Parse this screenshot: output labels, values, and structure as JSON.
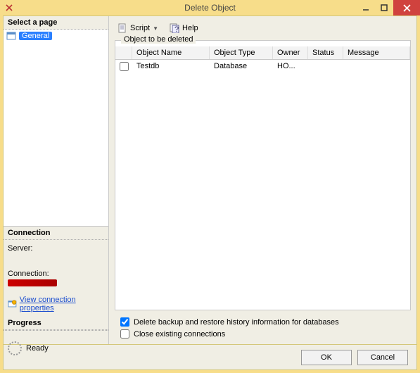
{
  "window": {
    "title": "Delete Object"
  },
  "left": {
    "pages_header": "Select a page",
    "page_general": "General",
    "connection": {
      "header": "Connection",
      "server_label": "Server:",
      "server_value": "",
      "connection_label": "Connection:",
      "view_props_link": "View connection properties"
    },
    "progress": {
      "header": "Progress",
      "status": "Ready"
    }
  },
  "toolbar": {
    "script": "Script",
    "help": "Help"
  },
  "group_label": "Object to be deleted",
  "columns": {
    "name": "Object Name",
    "type": "Object Type",
    "owner": "Owner",
    "status": "Status",
    "message": "Message"
  },
  "rows": [
    {
      "name": "Testdb",
      "type": "Database",
      "owner": "HO...",
      "status": "",
      "message": ""
    }
  ],
  "checks": {
    "delete_history": "Delete backup and restore history information for databases",
    "close_conn": "Close existing connections"
  },
  "buttons": {
    "ok": "OK",
    "cancel": "Cancel"
  }
}
